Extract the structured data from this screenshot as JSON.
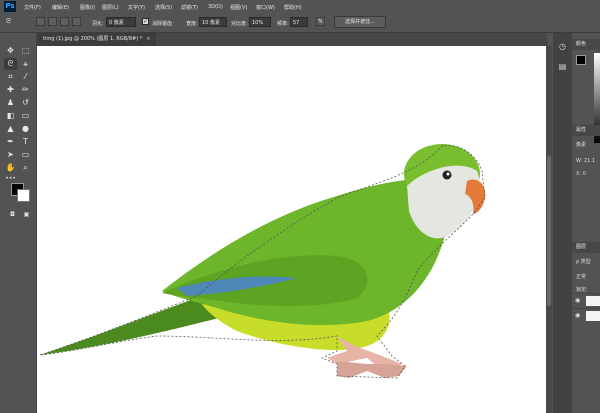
{
  "app": {
    "logo": "Ps"
  },
  "menu": [
    "文件(F)",
    "编辑(E)",
    "图像(I)",
    "图层(L)",
    "文字(Y)",
    "选择(S)",
    "滤镜(T)",
    "3D(D)",
    "视图(V)",
    "窗口(W)",
    "帮助(H)"
  ],
  "options": {
    "feather_label": "羽化:",
    "feather_value": "0 像素",
    "antialias_label": "消除锯齿",
    "antialias_checked": true,
    "width_label": "宽度:",
    "width_value": "10 像素",
    "contrast_label": "对比度:",
    "contrast_value": "10%",
    "frequency_label": "频率:",
    "frequency_value": "57",
    "select_mask_button": "选择并遮住..."
  },
  "document": {
    "tab_title": "timg (1).jpg @ 200% (图层 1, RGB/8#) *",
    "close_symbol": "×"
  },
  "panels": {
    "color_title": "颜色",
    "properties_title": "属性",
    "properties_row": "像素",
    "w_label": "W: 21.1",
    "x_label": "X: 0",
    "layers_title": "图层",
    "filter_kind": "ρ 类型",
    "blend_mode": "正常",
    "lock_label": "锁定:"
  },
  "colors": {
    "foreground": "#000000",
    "background": "#ffffff",
    "ui_bg": "#535353",
    "canvas": "#ffffff"
  },
  "tools": [
    "move-icon",
    "marquee-icon",
    "magnetic-lasso-icon",
    "magic-wand-icon",
    "crop-icon",
    "eyedropper-icon",
    "healing-icon",
    "brush-icon",
    "stamp-icon",
    "history-brush-icon",
    "eraser-icon",
    "gradient-icon",
    "blur-icon",
    "dodge-icon",
    "pen-icon",
    "type-icon",
    "path-select-icon",
    "rectangle-icon",
    "hand-icon",
    "zoom-icon"
  ]
}
